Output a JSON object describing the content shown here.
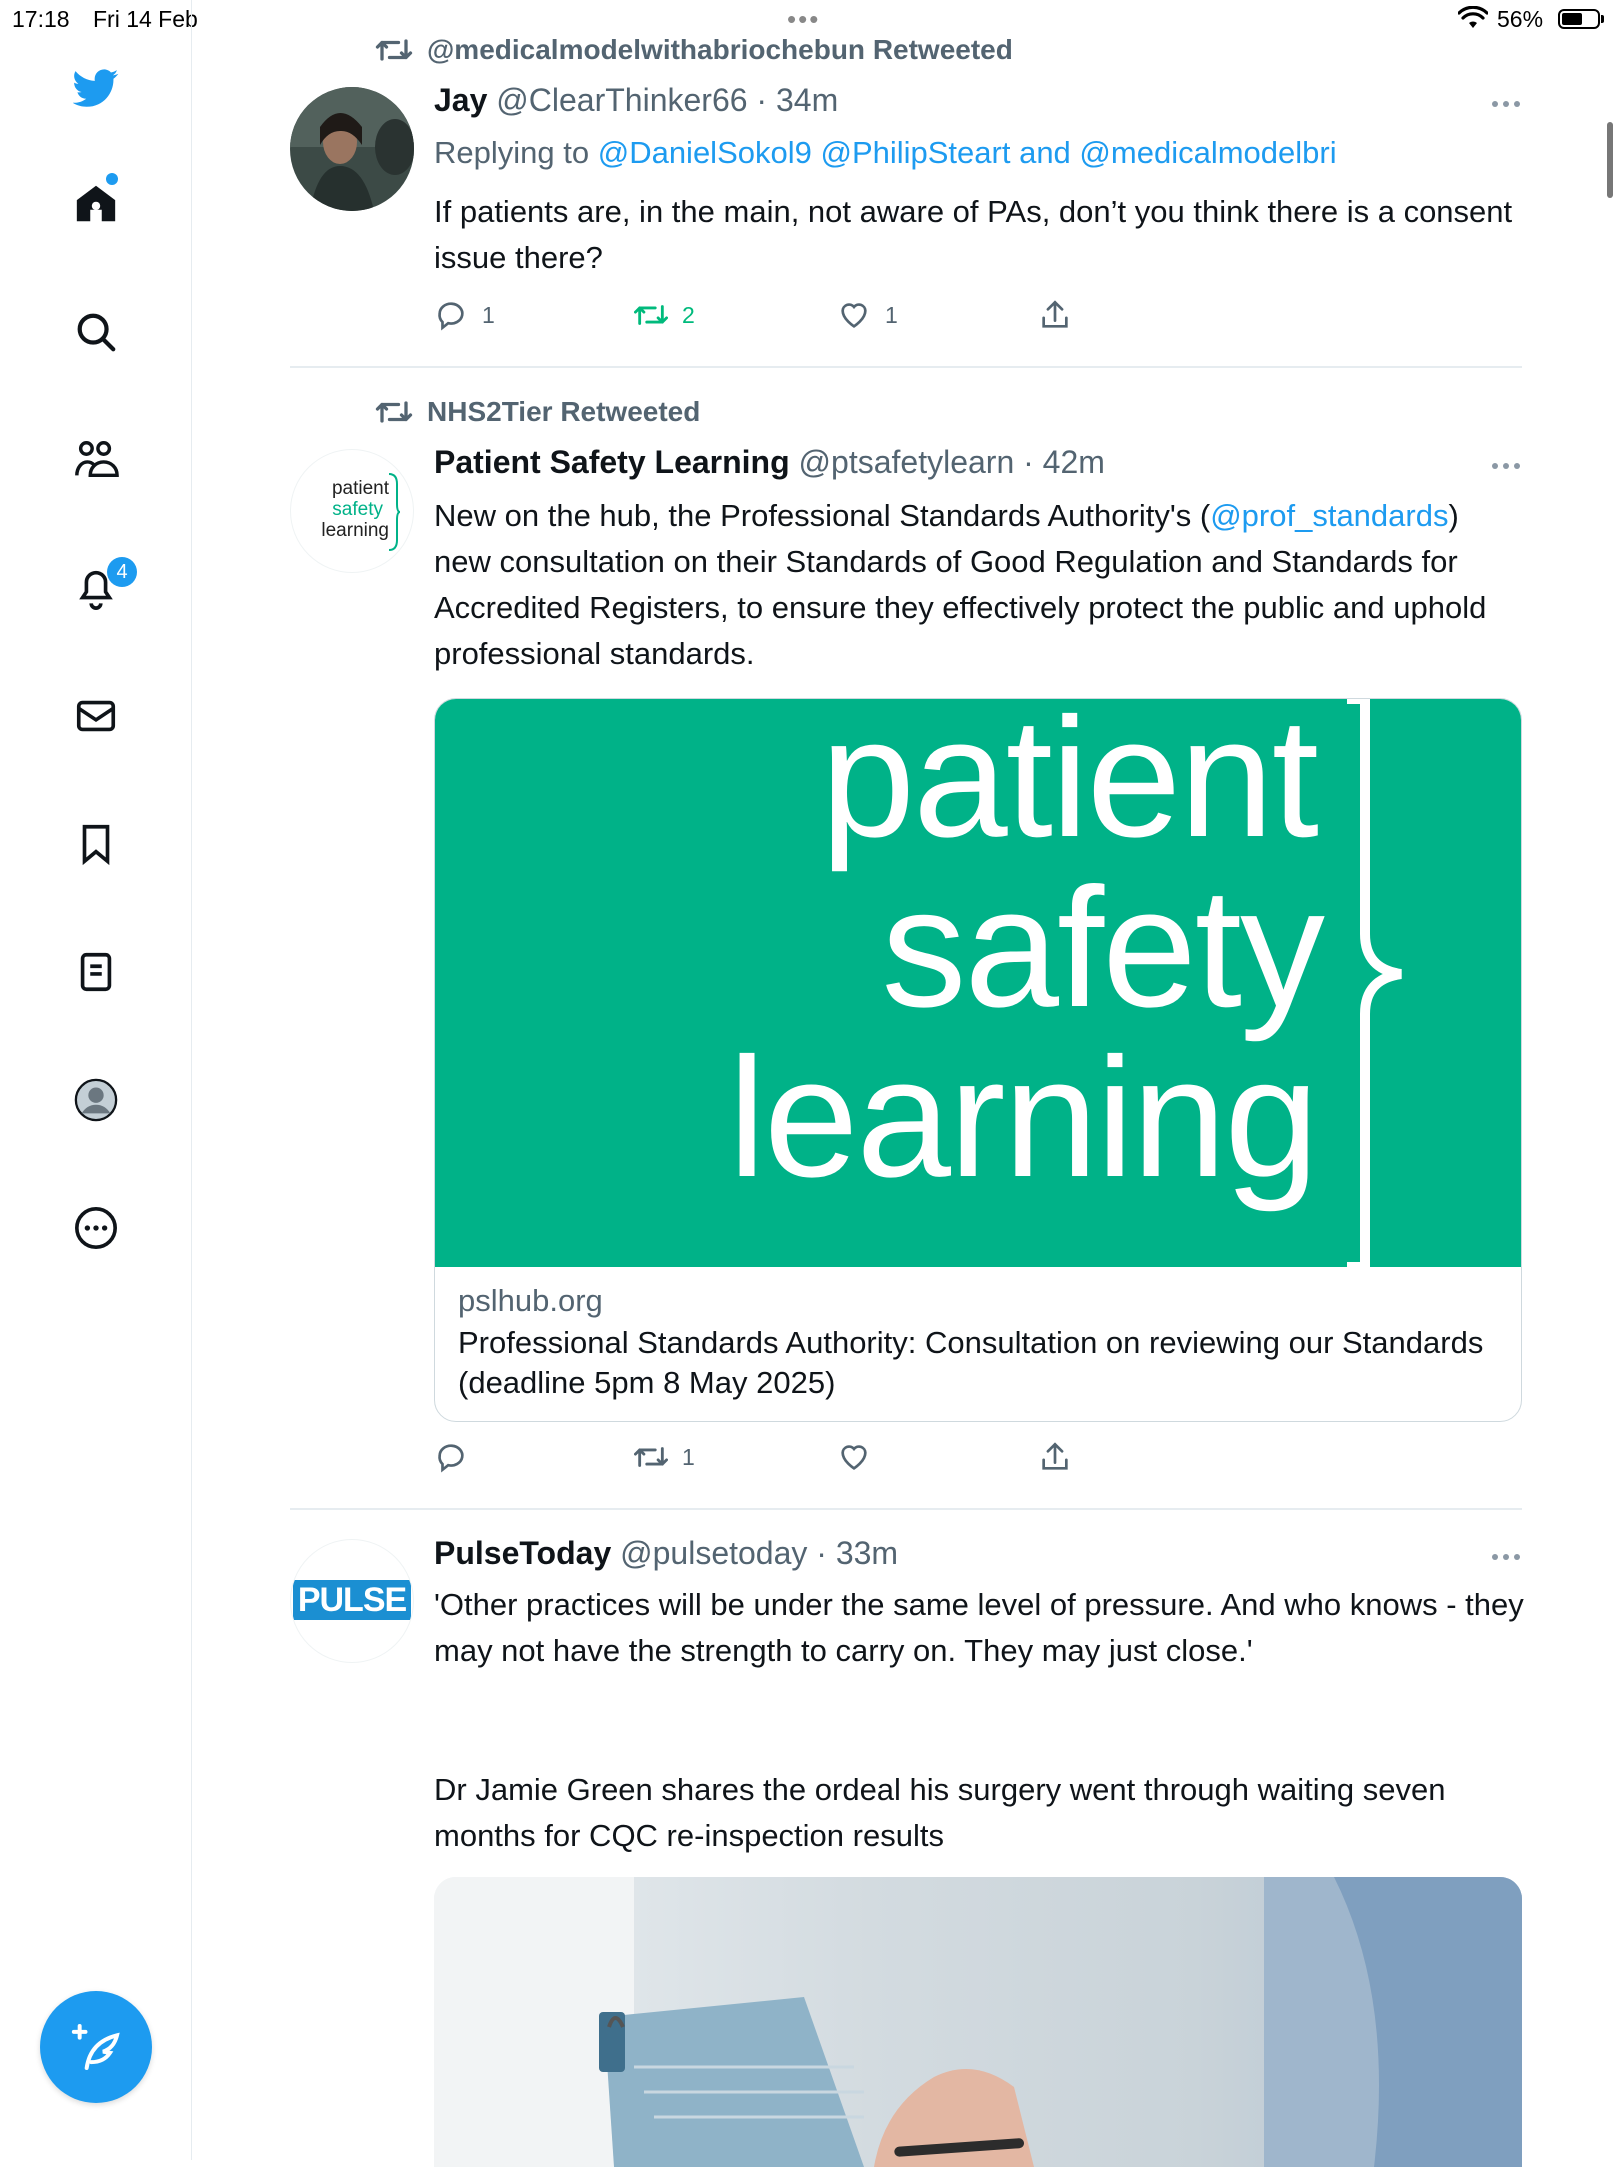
{
  "status_bar": {
    "time": "17:18",
    "date": "Fri 14 Feb",
    "battery": "56%"
  },
  "sidebar": {
    "items": [
      "twitter-logo",
      "home",
      "explore",
      "communities",
      "notifications",
      "messages",
      "bookmarks",
      "lists",
      "profile",
      "more"
    ],
    "notification_count": "4"
  },
  "tweets": [
    {
      "retweeted_by": "@medicalmodelwithabriochebun Retweeted",
      "name": "Jay",
      "handle": "@ClearThinker66",
      "time": "· 34m",
      "reply_prefix": "Replying to ",
      "reply_to": "@DanielSokol9 @PhilipSteart and @medicalmodelbri",
      "text": "If patients are, in the main, not aware of PAs, don’t you think there is a consent issue there?",
      "replies": "1",
      "retweets": "2",
      "likes": "1"
    },
    {
      "retweeted_by": "NHS2Tier Retweeted",
      "name": "Patient Safety Learning",
      "handle": "@ptsafetylearn",
      "time": "· 42m",
      "text_before": "New on the hub, the Professional Standards Authority's (",
      "mention": "@prof_standards",
      "text_after": ") new consultation on their Standards of Good Regulation and Standards for Accredited Registers, to ensure they effectively protect the public and uphold professional standards.",
      "avatar_logo": [
        "patient",
        "safety",
        "learning"
      ],
      "card": {
        "logo_lines": [
          "patient",
          "safety",
          "learning"
        ],
        "domain": "pslhub.org",
        "title": "Professional Standards Authority: Consultation on reviewing our Standards (deadline 5pm 8 May 2025)"
      },
      "replies": "",
      "retweets": "1",
      "likes": ""
    },
    {
      "name": "PulseToday",
      "handle": "@pulsetoday",
      "time": "· 33m",
      "avatar_logo": "PULSE",
      "text": "'Other practices will be under the same level of pressure. And who knows - they may not have the strength to carry on. They may just close.'",
      "text2": "Dr Jamie Green shares the ordeal his surgery went through waiting seven months for CQC re-inspection results"
    }
  ],
  "colors": {
    "accent": "#1d9bf0",
    "retweet_green": "#00ba7c",
    "psl_green": "#00b288",
    "secondary_text": "#536471"
  }
}
